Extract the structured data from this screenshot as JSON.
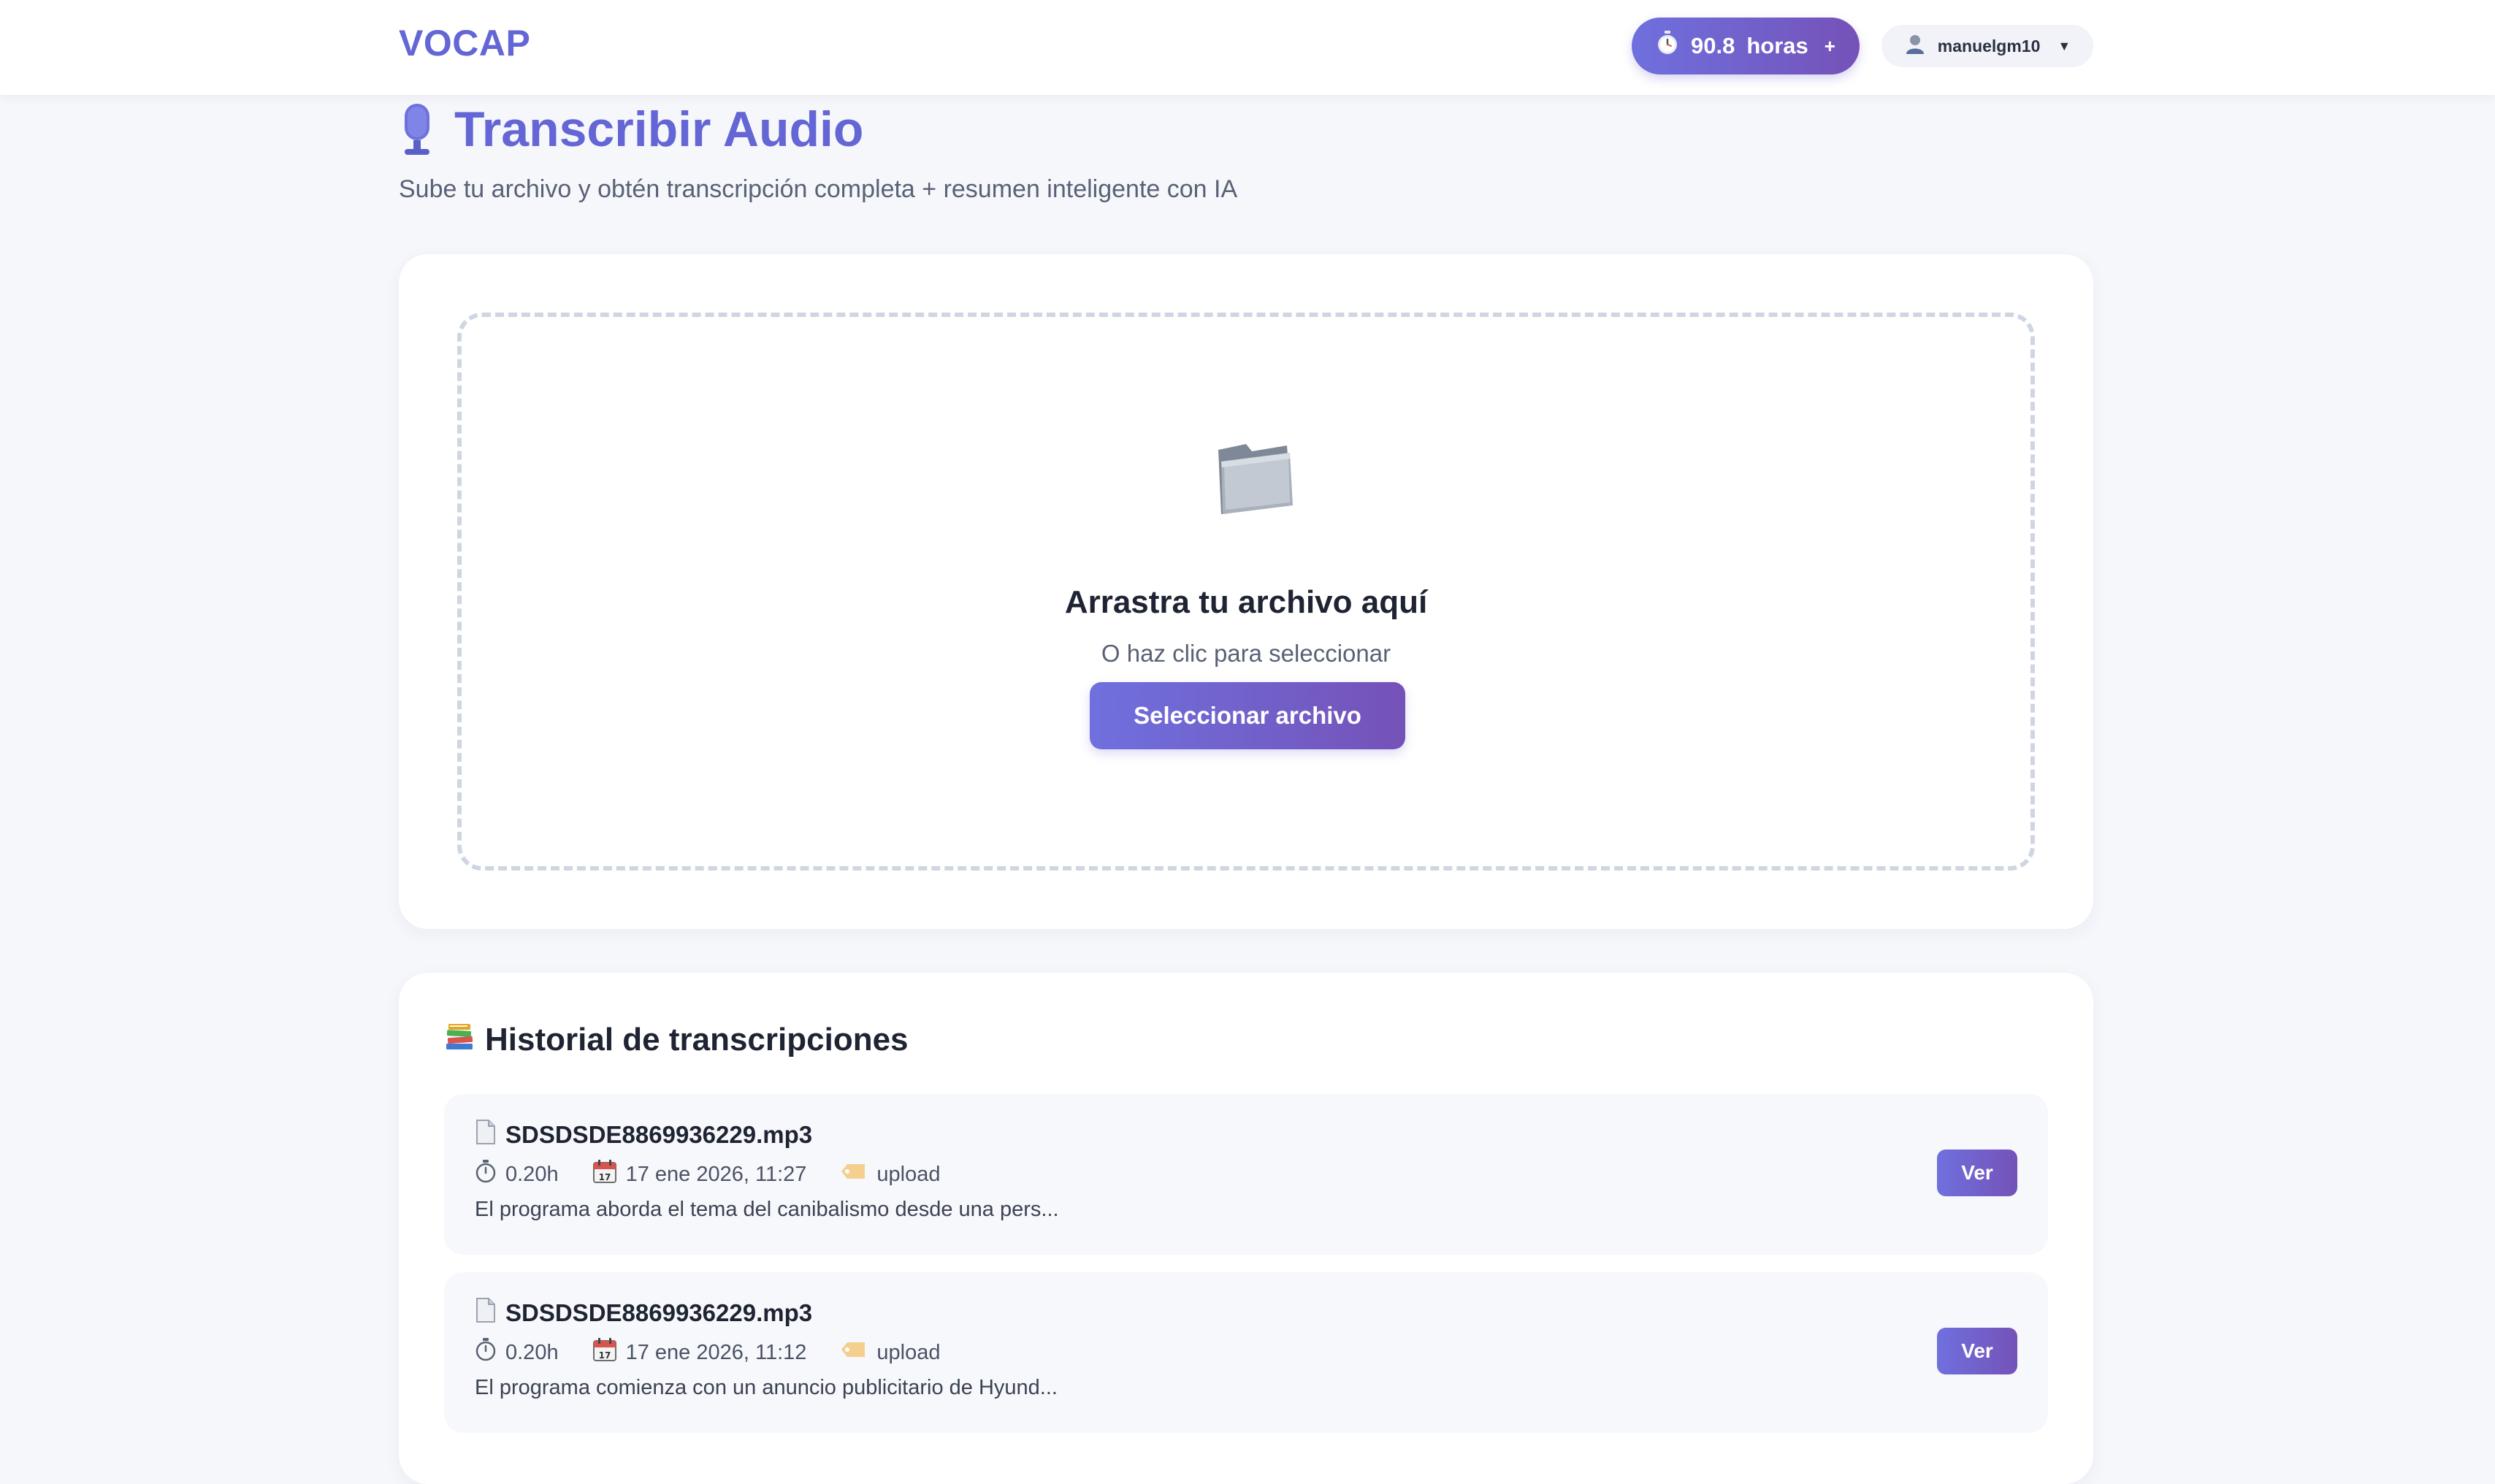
{
  "header": {
    "logo": "VOCAP",
    "hours": {
      "icon": "stopwatch-icon",
      "value": "90.8",
      "unit": "horas",
      "plus": "+"
    },
    "user": {
      "icon": "user-icon",
      "name": "manuelgm10",
      "caret": "▼"
    }
  },
  "page": {
    "title_icon": "microphone-icon",
    "title": "Transcribir Audio",
    "subtitle": "Sube tu archivo y obtén transcripción completa + resumen inteligente con IA"
  },
  "upload": {
    "icon": "folder-icon",
    "title": "Arrastra tu archivo aquí",
    "subtitle": "O haz clic para seleccionar",
    "button": "Seleccionar archivo"
  },
  "history": {
    "icon": "books-icon",
    "title": "Historial de transcripciones",
    "items": [
      {
        "filename": "SDSDSDE8869936229.mp3",
        "duration": "0.20h",
        "date": "17 ene 2026, 11:27",
        "source": "upload",
        "summary": "El programa aborda el tema del canibalismo desde una pers...",
        "button": "Ver"
      },
      {
        "filename": "SDSDSDE8869936229.mp3",
        "duration": "0.20h",
        "date": "17 ene 2026, 11:12",
        "source": "upload",
        "summary": "El programa comienza con un anuncio publicitario de Hyund...",
        "button": "Ver"
      }
    ]
  },
  "colors": {
    "accent": "#6366d4",
    "gradient_start": "#6f70de",
    "gradient_end": "#7552b8",
    "background": "#f6f7fb",
    "card": "#ffffff"
  }
}
